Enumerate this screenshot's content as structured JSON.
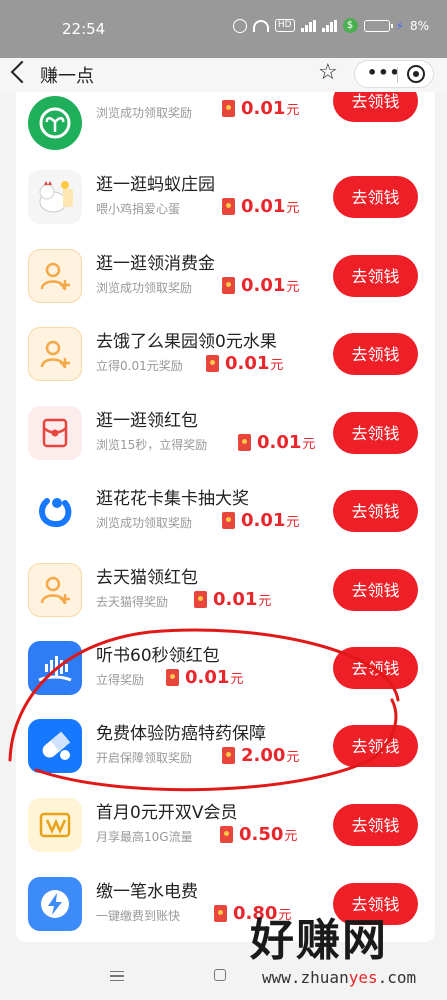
{
  "status_bar": {
    "time": "22:54",
    "net_tag": "HD",
    "battery": "8%"
  },
  "nav": {
    "title": "赚一点",
    "more": "•••"
  },
  "tasks": [
    {
      "title": "",
      "desc": "浏览成功领取奖励",
      "amount": "0.01",
      "unit": "元",
      "button": "去领钱",
      "icon": "sprout-icon",
      "icon_color": "#1fae5a"
    },
    {
      "title": "逛一逛蚂蚁庄园",
      "desc": "喂小鸡捐爱心蛋",
      "amount": "0.01",
      "unit": "元",
      "button": "去领钱",
      "icon": "chicken-icon",
      "icon_color": "#f5f5f5"
    },
    {
      "title": "逛一逛领消费金",
      "desc": "浏览成功领取奖励",
      "amount": "0.01",
      "unit": "元",
      "button": "去领钱",
      "icon": "person-plus-icon",
      "icon_color": "#fff3e0"
    },
    {
      "title": "去饿了么果园领0元水果",
      "desc": "立得0.01元奖励",
      "amount": "0.01",
      "unit": "元",
      "button": "去领钱",
      "icon": "person-plus-icon",
      "icon_color": "#fff3e0"
    },
    {
      "title": "逛一逛领红包",
      "desc": "浏览15秒，立得奖励",
      "amount": "0.01",
      "unit": "元",
      "button": "去领钱",
      "icon": "red-packet-icon",
      "icon_color": "#fdecec"
    },
    {
      "title": "逛花花卡集卡抽大奖",
      "desc": "浏览成功领取奖励",
      "amount": "0.01",
      "unit": "元",
      "button": "去领钱",
      "icon": "huabei-icon",
      "icon_color": "#ffffff"
    },
    {
      "title": "去天猫领红包",
      "desc": "去天猫得奖励",
      "amount": "0.01",
      "unit": "元",
      "button": "去领钱",
      "icon": "person-plus-icon",
      "icon_color": "#fff3e0"
    },
    {
      "title": "听书60秒领红包",
      "desc": "立得奖励",
      "amount": "0.01",
      "unit": "元",
      "button": "去领钱",
      "icon": "audiobook-icon",
      "icon_color": "#2f7df6"
    },
    {
      "title": "免费体验防癌特药保障",
      "desc": "开启保障领取奖励",
      "amount": "2.00",
      "unit": "元",
      "button": "去领钱",
      "icon": "pill-icon",
      "icon_color": "#1677ff"
    },
    {
      "title": "首月0元开双V会员",
      "desc": "月享最高10G流量",
      "amount": "0.50",
      "unit": "元",
      "button": "去领钱",
      "icon": "vip-icon",
      "icon_color": "#fff5d6"
    },
    {
      "title": "缴一笔水电费",
      "desc": "一键缴费到账快",
      "amount": "0.80",
      "unit": "元",
      "button": "去领钱",
      "icon": "lightning-icon",
      "icon_color": "#3d8bf8"
    }
  ],
  "watermark": {
    "brand": "好赚网",
    "url_prefix": "www.zhuan",
    "url_highlight": "yes",
    "url_suffix": ".com"
  },
  "colors": {
    "accent": "#ee1f27",
    "amount": "#e8272d",
    "annotation": "#e01818"
  }
}
